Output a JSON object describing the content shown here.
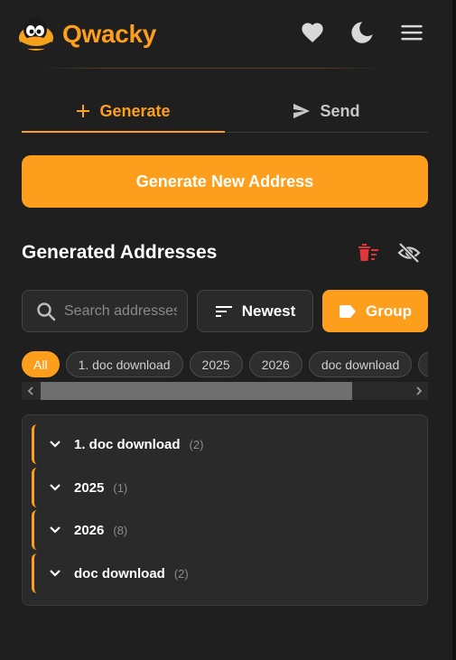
{
  "header": {
    "brand": "Qwacky",
    "icons": [
      "heart-icon",
      "moon-icon",
      "menu-icon"
    ]
  },
  "tabs": [
    {
      "label": "Generate",
      "icon": "plus-icon",
      "active": true
    },
    {
      "label": "Send",
      "icon": "send-icon",
      "active": false
    }
  ],
  "generate_button": {
    "label": "Generate New Address"
  },
  "section": {
    "title": "Generated Addresses",
    "icons": [
      "delete-list-icon",
      "eye-off-icon"
    ]
  },
  "controls": {
    "search_placeholder": "Search addresses...",
    "sort_label": "Newest",
    "group_label": "Group"
  },
  "chips": [
    "All",
    "1. doc download",
    "2025",
    "2026",
    "doc download",
    "U"
  ],
  "groups": [
    {
      "name": "1. doc download",
      "count": "(2)"
    },
    {
      "name": "2025",
      "count": "(1)"
    },
    {
      "name": "2026",
      "count": "(8)"
    },
    {
      "name": "doc download",
      "count": "(2)"
    }
  ],
  "colors": {
    "accent": "#fd9f1c",
    "background": "#1f1f1f",
    "panel": "#2a2a2a",
    "danger": "#e0353b"
  }
}
